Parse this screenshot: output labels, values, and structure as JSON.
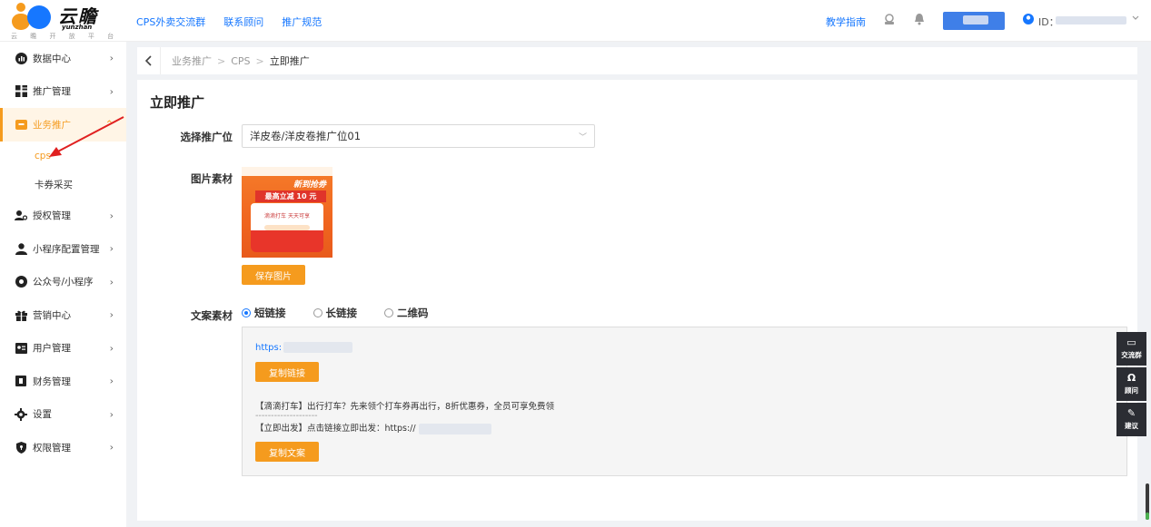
{
  "brand": {
    "name": "云瞻",
    "name_en": "yunzhan",
    "subtitle": "云 瞻 开 放 平 台"
  },
  "topnav": {
    "links": [
      "CPS外卖交流群",
      "联系顾问",
      "推广规范"
    ],
    "guide": "教学指南",
    "id_label": "ID："
  },
  "sidebar": {
    "items": [
      {
        "label": "数据中心",
        "icon": "chart-icon"
      },
      {
        "label": "推广管理",
        "icon": "grid-icon"
      },
      {
        "label": "业务推广",
        "icon": "briefcase-icon",
        "expanded": true
      },
      {
        "label": "授权管理",
        "icon": "user-key-icon"
      },
      {
        "label": "小程序配置管理",
        "icon": "user-icon"
      },
      {
        "label": "公众号/小程序",
        "icon": "wechat-icon"
      },
      {
        "label": "营销中心",
        "icon": "gift-icon"
      },
      {
        "label": "用户管理",
        "icon": "id-card-icon"
      },
      {
        "label": "财务管理",
        "icon": "finance-icon"
      },
      {
        "label": "设置",
        "icon": "gear-icon"
      },
      {
        "label": "权限管理",
        "icon": "lock-icon"
      }
    ],
    "sub_items": [
      {
        "label": "cps",
        "active": true
      },
      {
        "label": "卡券采买",
        "active": false
      }
    ]
  },
  "breadcrumb": {
    "items": [
      "业务推广",
      "CPS",
      "立即推广"
    ],
    "separator": ">"
  },
  "main": {
    "title": "立即推广",
    "select_label": "选择推广位",
    "select_value": "洋皮卷/洋皮卷推广位01",
    "image_label": "图片素材",
    "poster": {
      "tag": "新到抢劵",
      "amount": "最高立减 10 元",
      "card": "滴滴打车 天天可享"
    },
    "save_image_button": "保存图片",
    "copy_label": "文案素材",
    "radio_options": [
      {
        "label": "短链接",
        "checked": true
      },
      {
        "label": "长链接",
        "checked": false
      },
      {
        "label": "二维码",
        "checked": false
      }
    ],
    "link_prefix": "https:",
    "copy_link_button": "复制链接",
    "text_line1": "【滴滴打车】出行打车？先来领个打车券再出行，8折优惠券，全员可享免费领",
    "text_line2": "--------------------",
    "text_line3": "【立即出发】点击链接立即出发：https://",
    "copy_text_button": "复制文案"
  },
  "float_toolbar": [
    {
      "label": "交流群",
      "icon": "chat-icon"
    },
    {
      "label": "顾问",
      "icon": "headset-icon"
    },
    {
      "label": "建议",
      "icon": "edit-icon"
    }
  ],
  "colors": {
    "accent": "#f59b1e",
    "link": "#1677ff",
    "annotation_arrow": "#e02020"
  }
}
